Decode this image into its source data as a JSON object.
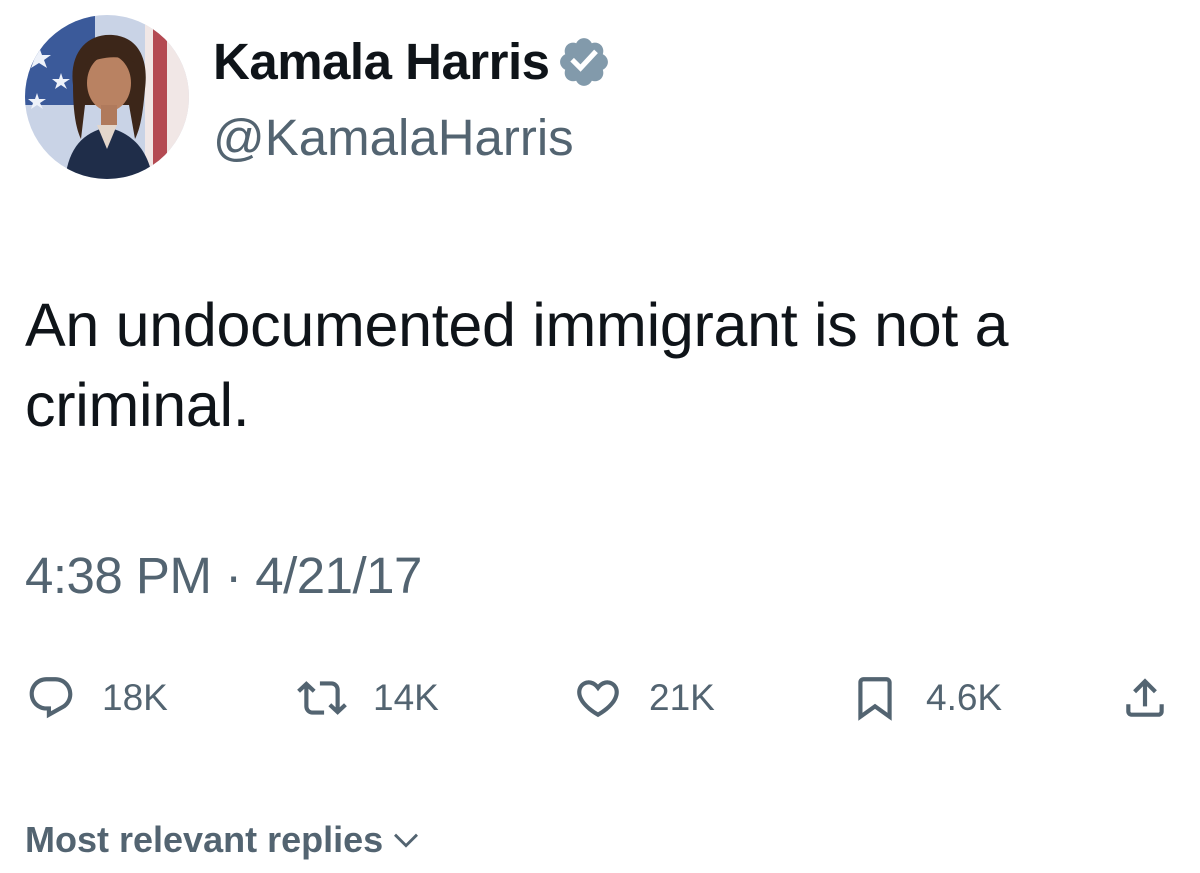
{
  "author": {
    "display_name": "Kamala Harris",
    "handle": "@KamalaHarris",
    "avatar_icon": "profile-photo",
    "verified_icon": "verified-badge-icon"
  },
  "tweet": {
    "text": "An undocumented immigrant is not a criminal.",
    "timestamp": "4:38 PM · 4/21/17"
  },
  "actions": {
    "replies": "18K",
    "retweets": "14K",
    "likes": "21K",
    "bookmarks": "4.6K",
    "reply_icon": "reply-icon",
    "retweet_icon": "retweet-icon",
    "like_icon": "heart-icon",
    "bookmark_icon": "bookmark-icon",
    "share_icon": "share-icon"
  },
  "replies_sort": {
    "label": "Most relevant replies",
    "icon": "chevron-down-icon"
  },
  "colors": {
    "text_primary": "#0f1419",
    "text_secondary": "#536471",
    "verified_badge": "#829aab",
    "background": "#ffffff"
  }
}
